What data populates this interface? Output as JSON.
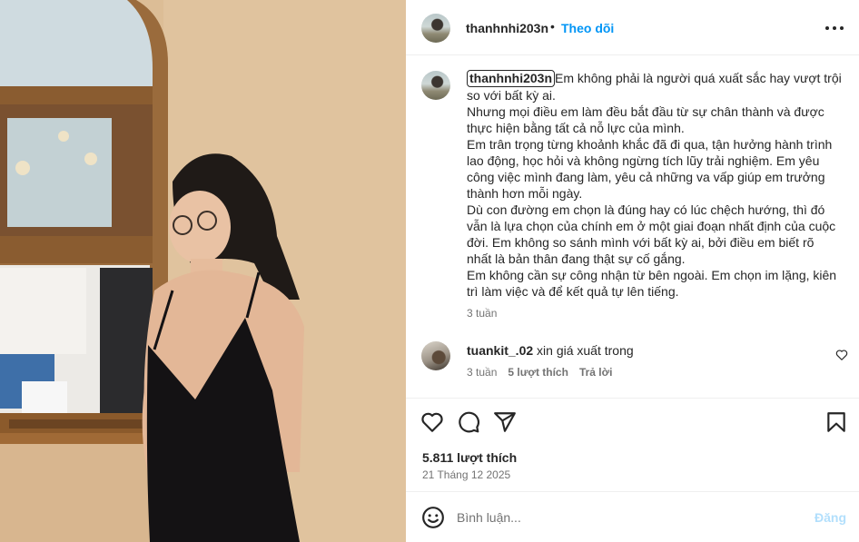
{
  "post": {
    "username": "thanhnhi203n",
    "separator": "•",
    "follow_label": "Theo dõi",
    "more_icon": "more-horizontal-icon"
  },
  "caption": {
    "username": "thanhnhi203n",
    "lines": [
      "Em không phải là người quá xuất sắc hay vượt trội",
      "so với bất kỳ ai.",
      "Nhưng mọi điều em làm đều bắt đầu từ sự chân thành và được",
      "thực hiện bằng tất cả nỗ lực của mình.",
      "Em trân trọng từng khoảnh khắc đã đi qua, tận hưởng hành trình",
      "lao động, học hỏi và không ngừng tích lũy trải nghiệm. Em yêu",
      "công việc mình đang làm, yêu cả những va vấp giúp em trưởng",
      "thành hơn mỗi ngày.",
      "Dù con đường em chọn là đúng hay có lúc chệch hướng, thì đó",
      "vẫn là lựa chọn của chính em ở một giai đoạn nhất định của cuộc",
      "đời. Em không so sánh mình với bất kỳ ai, bởi điều em biết rõ",
      "nhất là bản thân đang thật sự cố gắng.",
      "Em không cần sự công nhận từ bên ngoài. Em chọn im lặng, kiên",
      "trì làm việc và để kết quả tự lên tiếng."
    ],
    "time": "3 tuần"
  },
  "comments": [
    {
      "username": "tuankit_.02",
      "text": "xin giá xuất trong",
      "time": "3 tuần",
      "likes": "5 lượt thích",
      "reply_label": "Trả lời"
    }
  ],
  "actions": {
    "icons": [
      "heart-icon",
      "comment-icon",
      "share-icon",
      "bookmark-icon"
    ]
  },
  "stats": {
    "likes": "5.811 lượt thích",
    "date": "21 Tháng 12 2025"
  },
  "composer": {
    "placeholder": "Bình luận...",
    "post_label": "Đăng"
  },
  "colors": {
    "accent": "#0095f6",
    "post_disabled": "#b2dffc",
    "text": "#262626",
    "muted": "#737373"
  }
}
